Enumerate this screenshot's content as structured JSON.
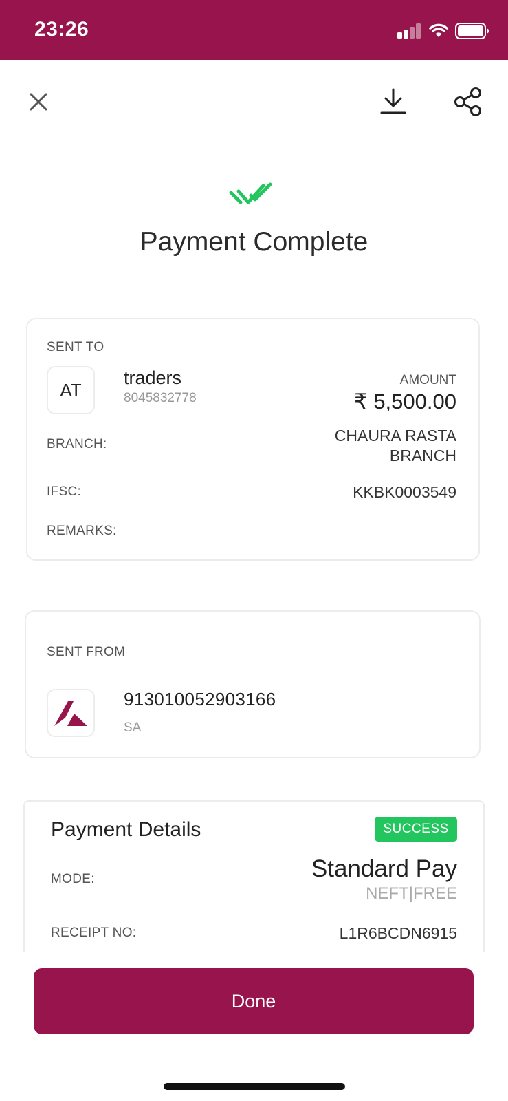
{
  "status_bar": {
    "time": "23:26",
    "color": "#97144d"
  },
  "toolbar": {
    "close_icon": "close-icon",
    "download_icon": "download-icon",
    "share_icon": "share-icon"
  },
  "title": "Payment Complete",
  "sent_to": {
    "section_label": "SENT TO",
    "avatar_initials": "AT",
    "name": "traders",
    "phone": "8045832778",
    "amount_label": "AMOUNT",
    "amount": "₹ 5,500.00",
    "branch_label": "BRANCH:",
    "branch_line1": "CHAURA RASTA",
    "branch_line2": "BRANCH",
    "ifsc_label": "IFSC:",
    "ifsc": "KKBK0003549",
    "remarks_label": "REMARKS:"
  },
  "sent_from": {
    "section_label": "SENT FROM",
    "account_number": "913010052903166",
    "account_type": "SA"
  },
  "payment_details": {
    "title": "Payment Details",
    "status": "SUCCESS",
    "mode_label": "MODE:",
    "mode": "Standard Pay",
    "mode_sub": "NEFT|FREE",
    "receipt_label": "RECEIPT NO:",
    "receipt_no": "L1R6BCDN6915"
  },
  "done_label": "Done",
  "colors": {
    "brand": "#97144d",
    "success": "#22c55e"
  }
}
